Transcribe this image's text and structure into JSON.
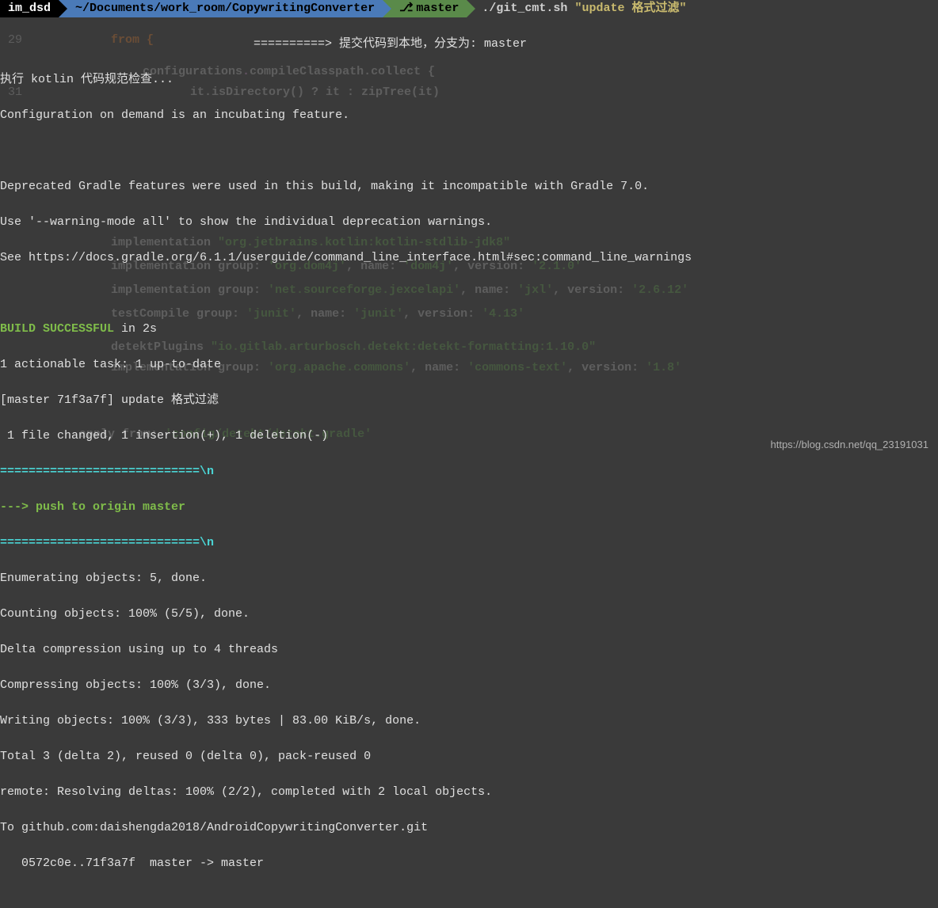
{
  "prompt": {
    "user": "im_dsd",
    "path": "~/Documents/work_room/CopywritingConverter",
    "branch_icon": "⎇",
    "branch": "master",
    "command": "./git_cmt.sh",
    "arg": "\"update 格式过滤\""
  },
  "bg": {
    "l29_num": "29",
    "l29": "from {",
    "l30": "configurations",
    "l30b": "compileClasspath",
    "l30c": ".collect {",
    "l31_num": "31",
    "l31a": "it.isDirectory() ? it : zipTree(it)",
    "l37a": "implementation",
    "l37b": "\"org.jetbrains.kotlin:kotlin-stdlib-jdk8\"",
    "l38a": "implementation group:",
    "l38b": "'org.dom4j'",
    "l38c": ", name:",
    "l38d": "'dom4j'",
    "l38e": ", version:",
    "l38f": "'2.1.0'",
    "l39a": "implementation group:",
    "l39b": "'net.sourceforge.jexcelapi'",
    "l39c": ", name:",
    "l39d": "'jxl'",
    "l39e": ", version:",
    "l39f": "'2.6.12'",
    "l40a": "testCompile group:",
    "l40b": "'junit'",
    "l40c": ", name:",
    "l40d": "'junit'",
    "l40e": ", version:",
    "l40f": "'4.13'",
    "l41a": "detektPlugins",
    "l41b": "\"io.gitlab.arturbosch.detekt:detekt-formatting:1.10.0\"",
    "l42a": "implementation group:",
    "l42b": "'org.apache.commons'",
    "l42c": ", name:",
    "l42d": "'commons-text'",
    "l42e": ", version:",
    "l42f": "'1.8'",
    "l44a": "apply",
    "l44b": "from:",
    "l44c": "'config/detekt/detekt.gradle'"
  },
  "out": {
    "l1": "==========> 提交代码到本地，分支为: master",
    "l2": "执行 kotlin 代码规范检查...",
    "l3": "Configuration on demand is an incubating feature.",
    "l4": "Deprecated Gradle features were used in this build, making it incompatible with Gradle 7.0.",
    "l5": "Use '--warning-mode all' to show the individual deprecation warnings.",
    "l6": "See https://docs.gradle.org/6.1.1/userguide/command_line_interface.html#sec:command_line_warnings",
    "l7a": "BUILD SUCCESSFUL",
    "l7b": " in 2s",
    "l8": "1 actionable task: 1 up-to-date",
    "l9": "[master 71f3a7f] update 格式过滤",
    "l10": " 1 file changed, 1 insertion(+), 1 deletion(-)",
    "l11": "============================\\n",
    "l12": "---> push to origin master",
    "l13": "============================\\n",
    "l14": "Enumerating objects: 5, done.",
    "l15": "Counting objects: 100% (5/5), done.",
    "l16": "Delta compression using up to 4 threads",
    "l17": "Compressing objects: 100% (3/3), done.",
    "l18": "Writing objects: 100% (3/3), 333 bytes | 83.00 KiB/s, done.",
    "l19": "Total 3 (delta 2), reused 0 (delta 0), pack-reused 0",
    "l20": "remote: Resolving deltas: 100% (2/2), completed with 2 local objects.",
    "l21": "To github.com:daishengda2018/AndroidCopywritingConverter.git",
    "l22": "   0572c0e..71f3a7f  master -> master"
  },
  "watermark": "https://blog.csdn.net/qq_23191031"
}
